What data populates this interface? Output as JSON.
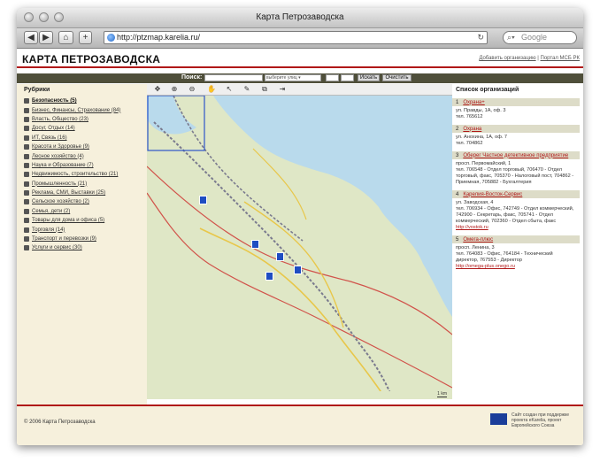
{
  "window": {
    "title": "Карта Петрозаводска"
  },
  "browser": {
    "url": "http://ptzmap.karelia.ru/",
    "search_placeholder": "Google",
    "back": "◀",
    "forward": "▶",
    "home": "⌂",
    "add": "+"
  },
  "site": {
    "title": "КАРТА ПЕТРОЗАВОДСКА",
    "links": [
      "Добавить организацию",
      "Портал МСБ РК"
    ],
    "link_sep": "|"
  },
  "search": {
    "label": "Поиск:",
    "select_placeholder": "выберите улиц",
    "search_button": "Искать",
    "clear_button": "Очистить"
  },
  "rubrics": {
    "title": "Рубрики",
    "items": [
      "Безопасность (5)",
      "Бизнес, Финансы, Страхование (84)",
      "Власть, Общество (23)",
      "Досуг, Отдых (14)",
      "ИТ, Связь (16)",
      "Красота и Здоровье (9)",
      "Лесное хозяйство (4)",
      "Наука и Образование (7)",
      "Недвижимость, строительство (21)",
      "Промышленность (21)",
      "Реклама, СМИ, Выставки (25)",
      "Сельское хозяйство (2)",
      "Семья, дети (2)",
      "Товары для дома и офиса (5)",
      "Торговля (14)",
      "Транспорт и перевозки (9)",
      "Услуги и сервис (30)"
    ]
  },
  "map": {
    "scale": "1 km"
  },
  "organizations": {
    "title": "Список организаций",
    "items": [
      {
        "num": "1",
        "name": "Охрана+",
        "lines": [
          "ул. Правды, 1А, оф. 3",
          "тел. 765612"
        ],
        "link": ""
      },
      {
        "num": "2",
        "name": "Охрана",
        "lines": [
          "ул. Анохина, 1А, оф. 7",
          "тел. 704862"
        ],
        "link": ""
      },
      {
        "num": "3",
        "name": "Оберег Частное детективное предприятие",
        "lines": [
          "просп. Первомайский, 1",
          "тел. 706548 - Отдел торговый, 706470 - Отдел торговый, факс, 705370 - Налоговый пост, 704862 - Приемная, 705882 - Бухгалтерия"
        ],
        "link": ""
      },
      {
        "num": "4",
        "name": "Карелия-Восток-Сервис",
        "lines": [
          "ул. Заводская, 4",
          "тел. 706934 - Офис, 742749 - Отдел коммерческий, 742900 - Секретарь, факс, 705741 - Отдел коммерческий, 702360 - Отдел сбыта, факс"
        ],
        "link": "http://vostok.ru"
      },
      {
        "num": "5",
        "name": "Омега-плюс",
        "lines": [
          "просп. Ленина, 3",
          "тел. 764083 - Офис, 764184 - Технический директор, 767553 - Директор"
        ],
        "link": "http://omega-plus.onego.ru"
      }
    ]
  },
  "footer": {
    "copyright": "© 2006 Карта Петрозаводска",
    "eu_text": "Сайт создан при поддержке проекта eKarelia, проект Европейского Союза"
  },
  "colors": {
    "accent": "#b01818",
    "panel": "#f6f0dc",
    "lake": "#b9daec",
    "searchbar": "#4f4f3a"
  }
}
